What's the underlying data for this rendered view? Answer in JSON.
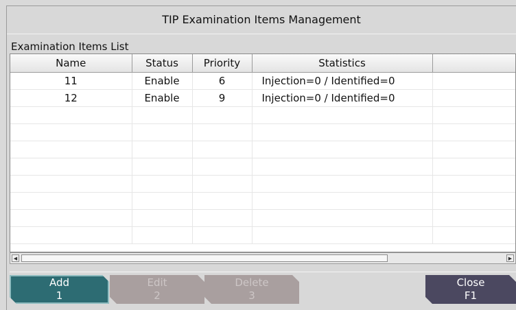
{
  "window": {
    "title": "TIP Examination Items Management"
  },
  "list": {
    "label": "Examination Items List",
    "columns": [
      "Name",
      "Status",
      "Priority",
      "Statistics",
      ""
    ],
    "rows": [
      [
        "11",
        "Enable",
        "6",
        "Injection=0 / Identified=0",
        ""
      ],
      [
        "12",
        "Enable",
        "9",
        "Injection=0 / Identified=0",
        ""
      ],
      [
        "",
        "",
        "",
        "",
        ""
      ],
      [
        "",
        "",
        "",
        "",
        ""
      ],
      [
        "",
        "",
        "",
        "",
        ""
      ],
      [
        "",
        "",
        "",
        "",
        ""
      ],
      [
        "",
        "",
        "",
        "",
        ""
      ],
      [
        "",
        "",
        "",
        "",
        ""
      ],
      [
        "",
        "",
        "",
        "",
        ""
      ],
      [
        "",
        "",
        "",
        "",
        ""
      ]
    ]
  },
  "buttons": {
    "add": {
      "label": "Add",
      "key": "1",
      "enabled": true
    },
    "edit": {
      "label": "Edit",
      "key": "2",
      "enabled": false
    },
    "delete": {
      "label": "Delete",
      "key": "3",
      "enabled": false
    },
    "close": {
      "label": "Close",
      "key": "F1",
      "enabled": true
    }
  }
}
